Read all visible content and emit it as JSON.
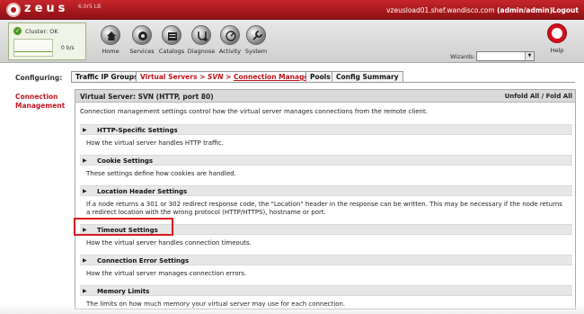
{
  "app": {
    "brand": "zeus",
    "version": "6.0r5 LB",
    "user_host": "vzeusload01.shef.wandisco.com",
    "user_role": "(admin/admin)",
    "logout_label": "Logout"
  },
  "cluster": {
    "status_label": "Cluster: OK",
    "throughput": "0 b/s"
  },
  "toolbar": {
    "items": [
      {
        "label": "Home",
        "icon": "home-icon"
      },
      {
        "label": "Services",
        "icon": "services-icon"
      },
      {
        "label": "Catalogs",
        "icon": "catalogs-icon"
      },
      {
        "label": "Diagnose",
        "icon": "diagnose-icon"
      },
      {
        "label": "Activity",
        "icon": "activity-icon"
      },
      {
        "label": "System",
        "icon": "system-icon"
      }
    ],
    "wizards_label": "Wizards:",
    "wizards_selected": "",
    "help_label": "Help"
  },
  "nav": {
    "configuring_label": "Configuring:",
    "tab_traffic_ip": "Traffic IP Groups",
    "tab_virtual_servers": "Virtual Servers",
    "tab_svn": "SVN",
    "tab_conn_mgmt": "Connection Management",
    "tab_sep": ">",
    "tab_pools": "Pools",
    "tab_config_summary": "Config Summary"
  },
  "page": {
    "side_title": "Connection Management",
    "panel_title": "Virtual Server: SVN (HTTP, port 80)",
    "unfold_label": "Unfold All",
    "fold_sep": "/",
    "fold_label": "Fold All",
    "description": "Connection management settings control how the virtual server manages connections from the remote client."
  },
  "sections": [
    {
      "title": "HTTP-Specific Settings",
      "desc": "How the virtual server handles HTTP traffic."
    },
    {
      "title": "Cookie Settings",
      "desc": "These settings define how cookies are handled."
    },
    {
      "title": "Location Header Settings",
      "desc": "If a node returns a 301 or 302 redirect response code, the \"Location\" header in the response can be written. This may be necessary if the node returns a redirect location with the wrong protocol (HTTP/HTTPS), hostname or port."
    },
    {
      "title": "Timeout Settings",
      "desc": "How the virtual server handles connection timeouts."
    },
    {
      "title": "Connection Error Settings",
      "desc": "How the virtual server manages connection errors."
    },
    {
      "title": "Memory Limits",
      "desc": "The limits on how much memory your virtual server may use for each connection."
    }
  ],
  "colors": {
    "brand_red": "#c01720",
    "highlight_red": "#d9171f"
  }
}
